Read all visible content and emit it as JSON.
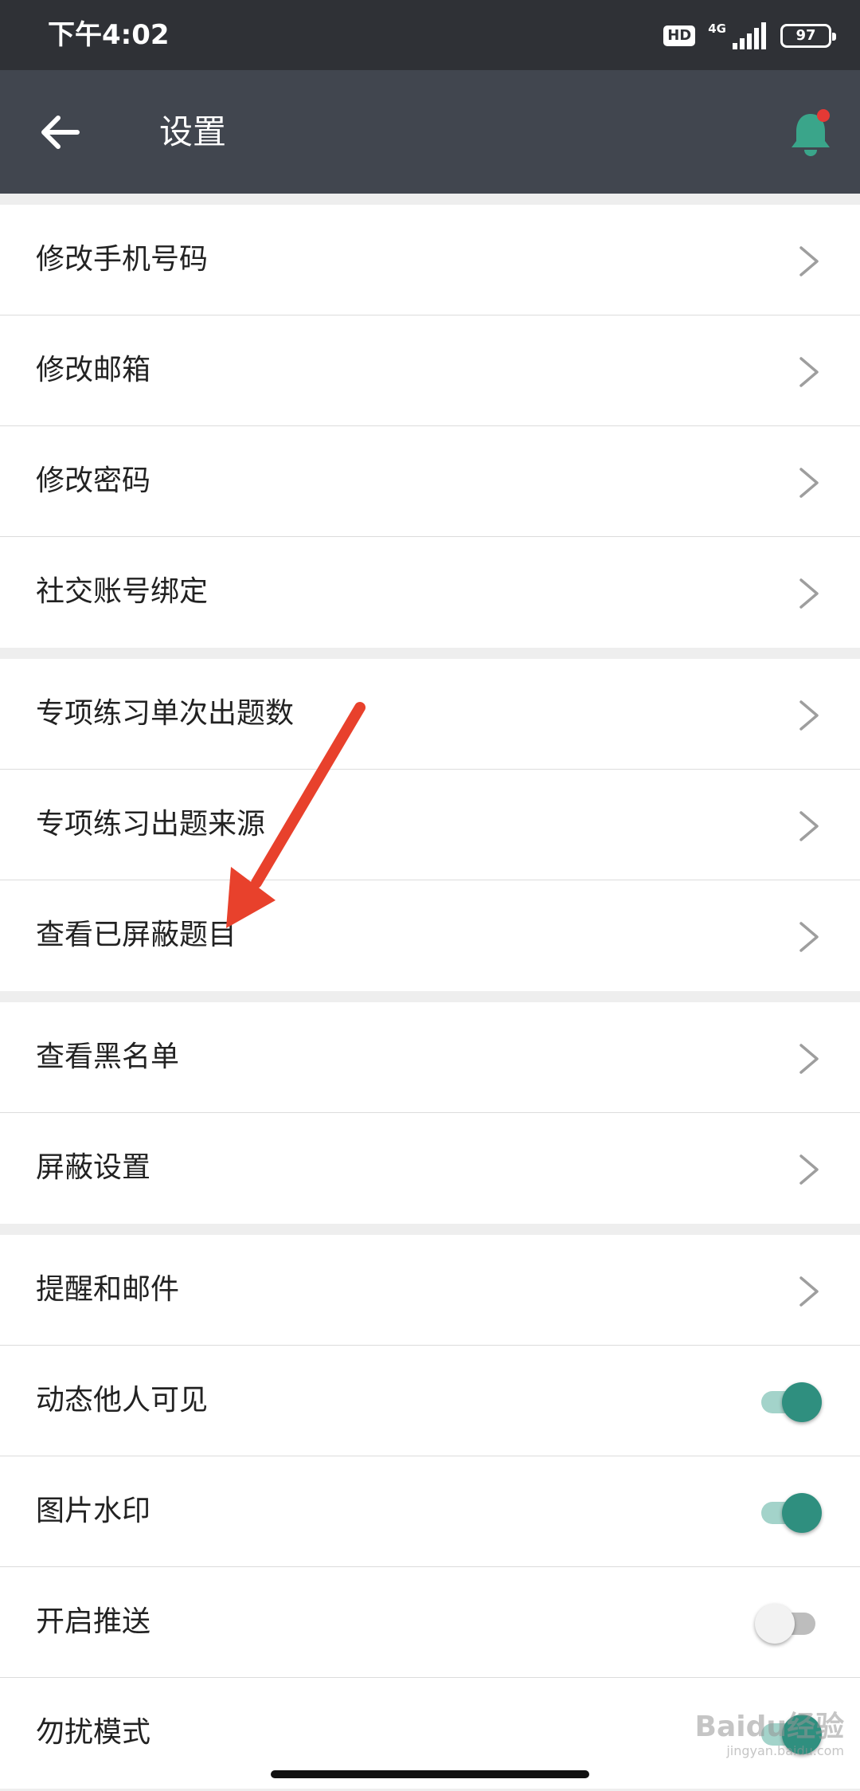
{
  "status_bar": {
    "time": "下午4:02",
    "hd_label": "HD",
    "network_label": "4G",
    "battery_level": "97"
  },
  "app_bar": {
    "title": "设置",
    "back_icon": "arrow-left-icon",
    "bell_icon": "bell-icon",
    "bell_color": "#3aa58a",
    "bell_dot_color": "#e53935"
  },
  "settings": {
    "groups": [
      {
        "items": [
          {
            "label": "修改手机号码",
            "control": "chevron"
          },
          {
            "label": "修改邮箱",
            "control": "chevron"
          },
          {
            "label": "修改密码",
            "control": "chevron"
          },
          {
            "label": "社交账号绑定",
            "control": "chevron"
          }
        ]
      },
      {
        "items": [
          {
            "label": "专项练习单次出题数",
            "control": "chevron"
          },
          {
            "label": "专项练习出题来源",
            "control": "chevron"
          },
          {
            "label": "查看已屏蔽题目",
            "control": "chevron"
          }
        ]
      },
      {
        "items": [
          {
            "label": "查看黑名单",
            "control": "chevron"
          },
          {
            "label": "屏蔽设置",
            "control": "chevron"
          }
        ]
      },
      {
        "items": [
          {
            "label": "提醒和邮件",
            "control": "chevron"
          },
          {
            "label": "动态他人可见",
            "control": "toggle",
            "on": true
          },
          {
            "label": "图片水印",
            "control": "toggle",
            "on": true
          },
          {
            "label": "开启推送",
            "control": "toggle",
            "on": false
          },
          {
            "label": "勿扰模式",
            "control": "toggle",
            "on": true
          }
        ]
      }
    ]
  },
  "annotation": {
    "arrow_color": "#e8412c"
  },
  "watermark": {
    "text": "Baidu经验",
    "subtext": "jingyan.baidu.com"
  },
  "colors": {
    "status_bar": "#2f3136",
    "app_bar": "#41464f",
    "toggle_on": "#2f8f7f",
    "toggle_off": "#f2f2f2"
  }
}
